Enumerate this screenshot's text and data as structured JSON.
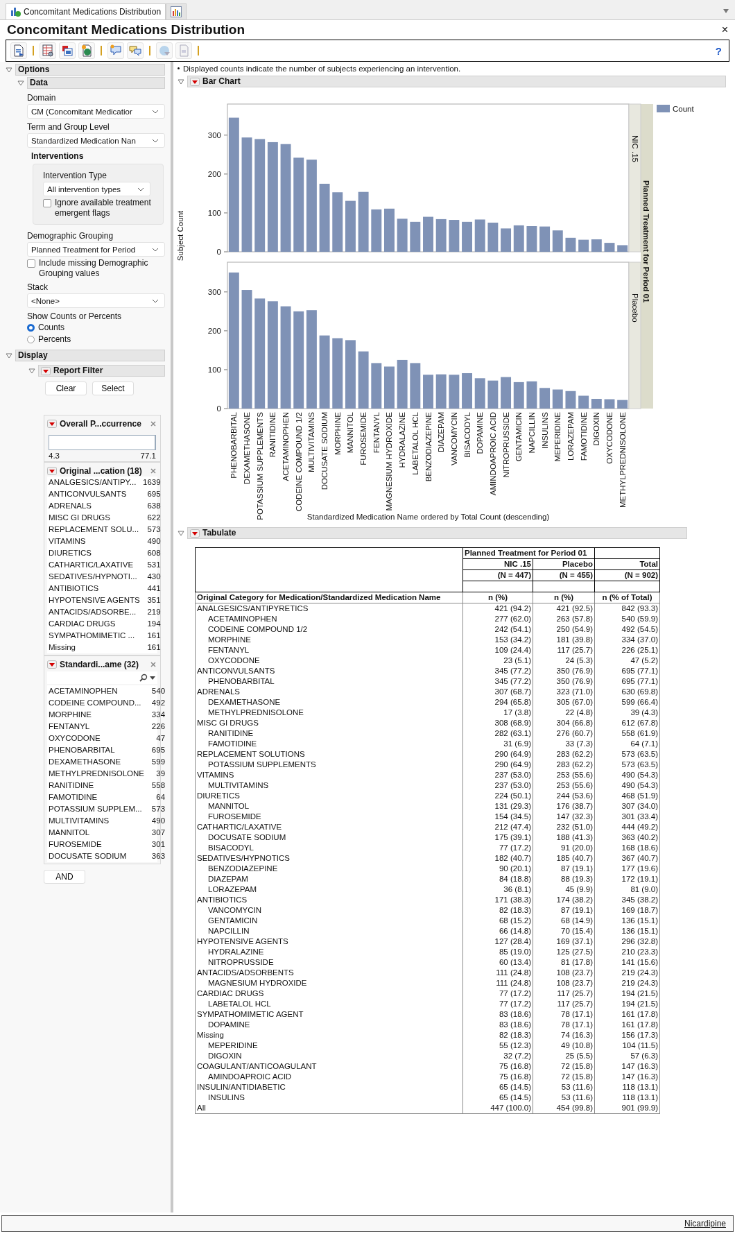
{
  "tabs": [
    {
      "kind": "report",
      "label": "Concomitant Medications Distribution",
      "selected": true
    },
    {
      "kind": "chart",
      "selected": false
    }
  ],
  "title": "Concomitant Medications Distribution",
  "close": "×",
  "help": "?",
  "options": {
    "header": "Options",
    "expanded": true,
    "data": {
      "header": "Data",
      "expanded": true,
      "domain": {
        "label": "Domain",
        "value": "CM (Concomitant Medicatior"
      },
      "term": {
        "label": "Term and Group Level",
        "value": "Standardized Medication Nan"
      },
      "interventions": {
        "label": "Interventions",
        "type_label": "Intervention Type",
        "type_value": "All intervention types",
        "ignore_flags": {
          "label": "Ignore available treatment emergent flags",
          "checked": false
        }
      },
      "grouping": {
        "label": "Demographic Grouping",
        "value": "Planned Treatment for Period"
      },
      "include_missing": {
        "label": "Include missing Demographic Grouping values",
        "checked": false
      },
      "stack": {
        "label": "Stack",
        "value": "<None>"
      },
      "show": {
        "label": "Show Counts or Percents",
        "choices": [
          {
            "label": "Counts",
            "selected": true
          },
          {
            "label": "Percents",
            "selected": false
          }
        ]
      }
    },
    "display": {
      "header": "Display",
      "expanded": true,
      "report_filter": {
        "header": "Report Filter",
        "expanded": true,
        "buttons": [
          "Clear",
          "Select"
        ],
        "range": {
          "header": "Overall P...ccurrence",
          "min": "4.3",
          "max": "77.1",
          "level": 1
        },
        "lists": [
          {
            "header": "Original ...cation (18)",
            "search": false,
            "items": [
              {
                "label": "ANALGESICS/ANTIPY...",
                "count": "1639"
              },
              {
                "label": "ANTICONVULSANTS",
                "count": "695"
              },
              {
                "label": "ADRENALS",
                "count": "638"
              },
              {
                "label": "MISC GI DRUGS",
                "count": "622"
              },
              {
                "label": "REPLACEMENT SOLU...",
                "count": "573"
              },
              {
                "label": "VITAMINS",
                "count": "490"
              },
              {
                "label": "DIURETICS",
                "count": "608"
              },
              {
                "label": "CATHARTIC/LAXATIVE",
                "count": "531"
              },
              {
                "label": "SEDATIVES/HYPNOTI...",
                "count": "430"
              },
              {
                "label": "ANTIBIOTICS",
                "count": "441"
              },
              {
                "label": "HYPOTENSIVE AGENTS",
                "count": "351"
              },
              {
                "label": "ANTACIDS/ADSORBE...",
                "count": "219"
              },
              {
                "label": "CARDIAC DRUGS",
                "count": "194"
              },
              {
                "label": "SYMPATHOMIMETIC ...",
                "count": "161"
              },
              {
                "label": "Missing",
                "count": "161"
              }
            ]
          },
          {
            "header": "Standardi...ame (32)",
            "search": true,
            "items": [
              {
                "label": "ACETAMINOPHEN",
                "count": "540"
              },
              {
                "label": "CODEINE COMPOUND...",
                "count": "492"
              },
              {
                "label": "MORPHINE",
                "count": "334"
              },
              {
                "label": "FENTANYL",
                "count": "226"
              },
              {
                "label": "OXYCODONE",
                "count": "47"
              },
              {
                "label": "PHENOBARBITAL",
                "count": "695"
              },
              {
                "label": "DEXAMETHASONE",
                "count": "599"
              },
              {
                "label": "METHYLPREDNISOLONE",
                "count": "39"
              },
              {
                "label": "RANITIDINE",
                "count": "558"
              },
              {
                "label": "FAMOTIDINE",
                "count": "64"
              },
              {
                "label": "POTASSIUM SUPPLEM...",
                "count": "573"
              },
              {
                "label": "MULTIVITAMINS",
                "count": "490"
              },
              {
                "label": "MANNITOL",
                "count": "307"
              },
              {
                "label": "FUROSEMIDE",
                "count": "301"
              },
              {
                "label": "DOCUSATE SODIUM",
                "count": "363"
              }
            ]
          }
        ],
        "and_button": "AND"
      }
    }
  },
  "note": "Displayed counts indicate the number of subjects experiencing an intervention.",
  "bar_chart": {
    "header": "Bar Chart",
    "expanded": true,
    "legend": "Count",
    "facet_label": "Planned Treatment for Period 01",
    "ylabel": "Subject Count",
    "panels": [
      {
        "strip": "NIC .15",
        "chart_data": {
          "type": "bar",
          "ylim": [
            0,
            380
          ],
          "yticks": [
            0,
            100,
            200,
            300
          ],
          "series": [
            {
              "color": "#7f92b6",
              "values": [
                345,
                294,
                290,
                282,
                277,
                242,
                237,
                175,
                153,
                131,
                154,
                109,
                111,
                85,
                77,
                90,
                84,
                82,
                77,
                83,
                75,
                60,
                68,
                66,
                65,
                55,
                36,
                31,
                32,
                23,
                17
              ]
            }
          ]
        }
      },
      {
        "strip": "Placebo",
        "chart_data": {
          "type": "bar",
          "xlabel": "Standardized Medication Name ordered by Total Count (descending)",
          "ylim": [
            0,
            380
          ],
          "yticks": [
            0,
            100,
            200,
            300
          ],
          "categories": [
            "PHENOBARBITAL",
            "DEXAMETHASONE",
            "POTASSIUM SUPPLEMENTS",
            "RANITIDINE",
            "ACETAMINOPHEN",
            "CODEINE COMPOUND 1/2",
            "MULTIVITAMINS",
            "DOCUSATE SODIUM",
            "MORPHINE",
            "MANNITOL",
            "FUROSEMIDE",
            "FENTANYL",
            "MAGNESIUM HYDROXIDE",
            "HYDRALAZINE",
            "LABETALOL HCL",
            "BENZODIAZEPINE",
            "DIAZEPAM",
            "VANCOMYCIN",
            "BISACODYL",
            "DOPAMINE",
            "AMINDOAPROIC ACID",
            "NITROPRUSSIDE",
            "GENTAMICIN",
            "NAPCILLIN",
            "INSULINS",
            "MEPERIDINE",
            "LORAZEPAM",
            "FAMOTIDINE",
            "DIGOXIN",
            "OXYCODONE",
            "METHYLPREDNISOLONE"
          ],
          "series": [
            {
              "color": "#7f92b6",
              "values": [
                350,
                305,
                283,
                276,
                263,
                250,
                253,
                188,
                181,
                176,
                147,
                117,
                108,
                125,
                117,
                87,
                88,
                87,
                91,
                78,
                72,
                81,
                68,
                70,
                53,
                49,
                45,
                33,
                25,
                24,
                22
              ]
            }
          ]
        }
      }
    ]
  },
  "tabulate": {
    "header": "Tabulate",
    "expanded": true,
    "group_header": "Planned Treatment for Period 01",
    "columns": [
      {
        "name": "NIC .15",
        "n": "(N = 447)",
        "stat": "n (%)"
      },
      {
        "name": "Placebo",
        "n": "(N = 455)",
        "stat": "n (%)"
      },
      {
        "name": "Total",
        "n": "(N = 902)",
        "stat": "n (% of Total)"
      }
    ],
    "row_header": "Original Category for Medication/Standardized Medication Name",
    "rows": [
      {
        "label": "ANALGESICS/ANTIPYRETICS",
        "values": [
          "421 (94.2)",
          "421 (92.5)",
          "842 (93.3)"
        ],
        "children": [
          {
            "label": "ACETAMINOPHEN",
            "values": [
              "277 (62.0)",
              "263 (57.8)",
              "540 (59.9)"
            ]
          },
          {
            "label": "CODEINE COMPOUND 1/2",
            "values": [
              "242 (54.1)",
              "250 (54.9)",
              "492 (54.5)"
            ]
          },
          {
            "label": "MORPHINE",
            "values": [
              "153 (34.2)",
              "181 (39.8)",
              "334 (37.0)"
            ]
          },
          {
            "label": "FENTANYL",
            "values": [
              "109 (24.4)",
              "117 (25.7)",
              "226 (25.1)"
            ]
          },
          {
            "label": "OXYCODONE",
            "values": [
              "23 (5.1)",
              "24 (5.3)",
              "47 (5.2)"
            ]
          }
        ]
      },
      {
        "label": "ANTICONVULSANTS",
        "values": [
          "345 (77.2)",
          "350 (76.9)",
          "695 (77.1)"
        ],
        "children": [
          {
            "label": "PHENOBARBITAL",
            "values": [
              "345 (77.2)",
              "350 (76.9)",
              "695 (77.1)"
            ]
          }
        ]
      },
      {
        "label": "ADRENALS",
        "values": [
          "307 (68.7)",
          "323 (71.0)",
          "630 (69.8)"
        ],
        "children": [
          {
            "label": "DEXAMETHASONE",
            "values": [
              "294 (65.8)",
              "305 (67.0)",
              "599 (66.4)"
            ]
          },
          {
            "label": "METHYLPREDNISOLONE",
            "values": [
              "17 (3.8)",
              "22 (4.8)",
              "39 (4.3)"
            ]
          }
        ]
      },
      {
        "label": "MISC GI DRUGS",
        "values": [
          "308 (68.9)",
          "304 (66.8)",
          "612 (67.8)"
        ],
        "children": [
          {
            "label": "RANITIDINE",
            "values": [
              "282 (63.1)",
              "276 (60.7)",
              "558 (61.9)"
            ]
          },
          {
            "label": "FAMOTIDINE",
            "values": [
              "31 (6.9)",
              "33 (7.3)",
              "64 (7.1)"
            ]
          }
        ]
      },
      {
        "label": "REPLACEMENT SOLUTIONS",
        "values": [
          "290 (64.9)",
          "283 (62.2)",
          "573 (63.5)"
        ],
        "children": [
          {
            "label": "POTASSIUM SUPPLEMENTS",
            "values": [
              "290 (64.9)",
              "283 (62.2)",
              "573 (63.5)"
            ]
          }
        ]
      },
      {
        "label": "VITAMINS",
        "values": [
          "237 (53.0)",
          "253 (55.6)",
          "490 (54.3)"
        ],
        "children": [
          {
            "label": "MULTIVITAMINS",
            "values": [
              "237 (53.0)",
              "253 (55.6)",
              "490 (54.3)"
            ]
          }
        ]
      },
      {
        "label": "DIURETICS",
        "values": [
          "224 (50.1)",
          "244 (53.6)",
          "468 (51.9)"
        ],
        "children": [
          {
            "label": "MANNITOL",
            "values": [
              "131 (29.3)",
              "176 (38.7)",
              "307 (34.0)"
            ]
          },
          {
            "label": "FUROSEMIDE",
            "values": [
              "154 (34.5)",
              "147 (32.3)",
              "301 (33.4)"
            ]
          }
        ]
      },
      {
        "label": "CATHARTIC/LAXATIVE",
        "values": [
          "212 (47.4)",
          "232 (51.0)",
          "444 (49.2)"
        ],
        "children": [
          {
            "label": "DOCUSATE SODIUM",
            "values": [
              "175 (39.1)",
              "188 (41.3)",
              "363 (40.2)"
            ]
          },
          {
            "label": "BISACODYL",
            "values": [
              "77 (17.2)",
              "91 (20.0)",
              "168 (18.6)"
            ]
          }
        ]
      },
      {
        "label": "SEDATIVES/HYPNOTICS",
        "values": [
          "182 (40.7)",
          "185 (40.7)",
          "367 (40.7)"
        ],
        "children": [
          {
            "label": "BENZODIAZEPINE",
            "values": [
              "90 (20.1)",
              "87 (19.1)",
              "177 (19.6)"
            ]
          },
          {
            "label": "DIAZEPAM",
            "values": [
              "84 (18.8)",
              "88 (19.3)",
              "172 (19.1)"
            ]
          },
          {
            "label": "LORAZEPAM",
            "values": [
              "36 (8.1)",
              "45 (9.9)",
              "81 (9.0)"
            ]
          }
        ]
      },
      {
        "label": "ANTIBIOTICS",
        "values": [
          "171 (38.3)",
          "174 (38.2)",
          "345 (38.2)"
        ],
        "children": [
          {
            "label": "VANCOMYCIN",
            "values": [
              "82 (18.3)",
              "87 (19.1)",
              "169 (18.7)"
            ]
          },
          {
            "label": "GENTAMICIN",
            "values": [
              "68 (15.2)",
              "68 (14.9)",
              "136 (15.1)"
            ]
          },
          {
            "label": "NAPCILLIN",
            "values": [
              "66 (14.8)",
              "70 (15.4)",
              "136 (15.1)"
            ]
          }
        ]
      },
      {
        "label": "HYPOTENSIVE AGENTS",
        "values": [
          "127 (28.4)",
          "169 (37.1)",
          "296 (32.8)"
        ],
        "children": [
          {
            "label": "HYDRALAZINE",
            "values": [
              "85 (19.0)",
              "125 (27.5)",
              "210 (23.3)"
            ]
          },
          {
            "label": "NITROPRUSSIDE",
            "values": [
              "60 (13.4)",
              "81 (17.8)",
              "141 (15.6)"
            ]
          }
        ]
      },
      {
        "label": "ANTACIDS/ADSORBENTS",
        "values": [
          "111 (24.8)",
          "108 (23.7)",
          "219 (24.3)"
        ],
        "children": [
          {
            "label": "MAGNESIUM HYDROXIDE",
            "values": [
              "111 (24.8)",
              "108 (23.7)",
              "219 (24.3)"
            ]
          }
        ]
      },
      {
        "label": "CARDIAC DRUGS",
        "values": [
          "77 (17.2)",
          "117 (25.7)",
          "194 (21.5)"
        ],
        "children": [
          {
            "label": "LABETALOL HCL",
            "values": [
              "77 (17.2)",
              "117 (25.7)",
              "194 (21.5)"
            ]
          }
        ]
      },
      {
        "label": "SYMPATHOMIMETIC AGENT",
        "values": [
          "83 (18.6)",
          "78 (17.1)",
          "161 (17.8)"
        ],
        "children": [
          {
            "label": "DOPAMINE",
            "values": [
              "83 (18.6)",
              "78 (17.1)",
              "161 (17.8)"
            ]
          }
        ]
      },
      {
        "label": "Missing",
        "values": [
          "82 (18.3)",
          "74 (16.3)",
          "156 (17.3)"
        ],
        "children": [
          {
            "label": "MEPERIDINE",
            "values": [
              "55 (12.3)",
              "49 (10.8)",
              "104 (11.5)"
            ]
          },
          {
            "label": "DIGOXIN",
            "values": [
              "32 (7.2)",
              "25 (5.5)",
              "57 (6.3)"
            ]
          }
        ]
      },
      {
        "label": "COAGULANT/ANTICOAGULANT",
        "values": [
          "75 (16.8)",
          "72 (15.8)",
          "147 (16.3)"
        ],
        "children": [
          {
            "label": "AMINDOAPROIC ACID",
            "values": [
              "75 (16.8)",
              "72 (15.8)",
              "147 (16.3)"
            ]
          }
        ]
      },
      {
        "label": "INSULIN/ANTIDIABETIC",
        "values": [
          "65 (14.5)",
          "53 (11.6)",
          "118 (13.1)"
        ],
        "children": [
          {
            "label": "INSULINS",
            "values": [
              "65 (14.5)",
              "53 (11.6)",
              "118 (13.1)"
            ]
          }
        ]
      },
      {
        "label": "All",
        "values": [
          "447 (100.0)",
          "454 (99.8)",
          "901 (99.9)"
        ]
      }
    ]
  },
  "status_bar": {
    "link": "Nicardipine"
  }
}
